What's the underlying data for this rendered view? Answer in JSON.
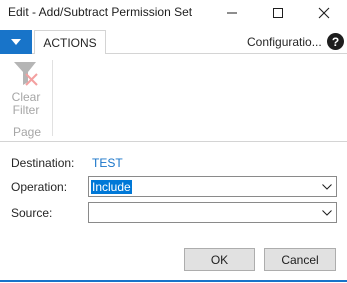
{
  "window": {
    "title": "Edit - Add/Subtract Permission Set",
    "accent_color": "#1874c9"
  },
  "ribbon": {
    "tab_actions_label": "ACTIONS",
    "configuration_label": "Configuratio...",
    "help_label": "?",
    "clear_filter_line1": "Clear",
    "clear_filter_line2": "Filter",
    "group_label": "Page"
  },
  "form": {
    "destination_label": "Destination:",
    "destination_value": "TEST",
    "operation_label": "Operation:",
    "operation_value": "Include",
    "source_label": "Source:",
    "source_value": ""
  },
  "buttons": {
    "ok_label": "OK",
    "cancel_label": "Cancel"
  },
  "icons": {
    "minimize": "minimize-icon",
    "maximize": "maximize-icon",
    "close": "close-icon",
    "app_menu": "dropdown-arrow-icon",
    "clear_filter": "funnel-clear-icon",
    "combo_arrow": "chevron-down-icon"
  }
}
